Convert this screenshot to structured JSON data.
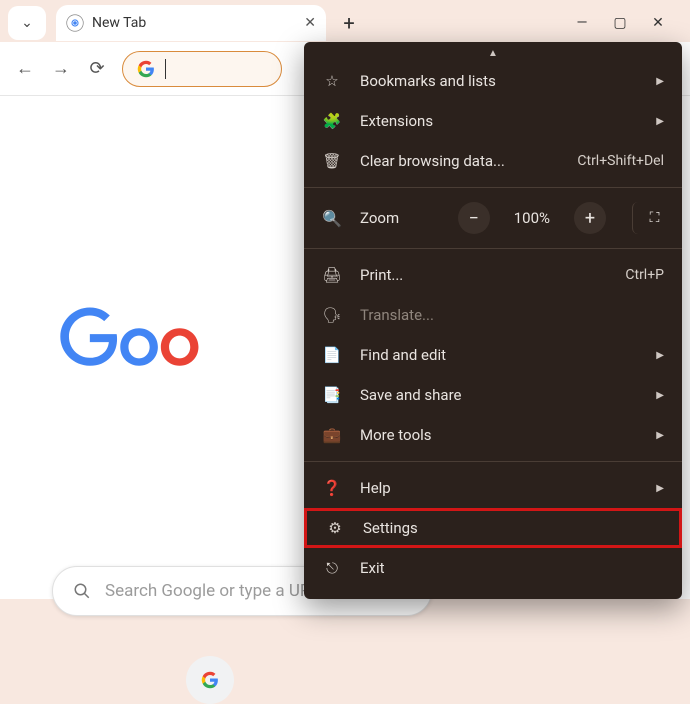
{
  "tab": {
    "title": "New Tab"
  },
  "searchbox": {
    "placeholder": "Search Google or type a URL"
  },
  "menu": {
    "bookmarks": "Bookmarks and lists",
    "extensions": "Extensions",
    "clear": "Clear browsing data...",
    "clear_hint": "Ctrl+Shift+Del",
    "zoom_label": "Zoom",
    "zoom_value": "100%",
    "print": "Print...",
    "print_hint": "Ctrl+P",
    "translate": "Translate...",
    "find": "Find and edit",
    "save": "Save and share",
    "moretools": "More tools",
    "help": "Help",
    "settings": "Settings",
    "exit": "Exit"
  }
}
